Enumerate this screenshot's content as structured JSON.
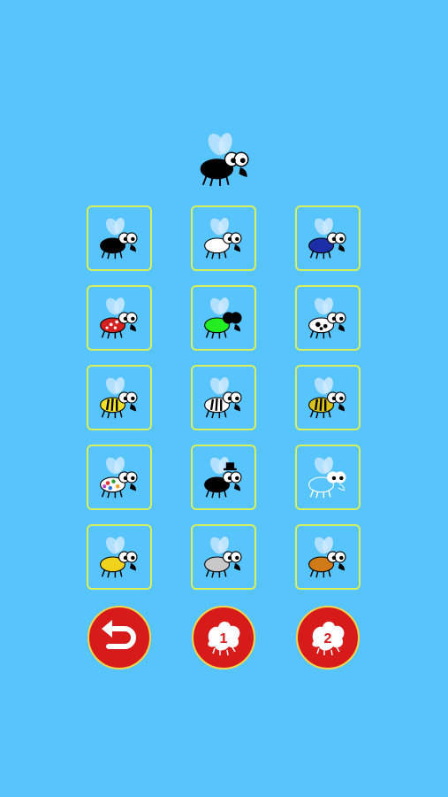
{
  "preview": {
    "skin": "black"
  },
  "skins": [
    {
      "name": "black",
      "body": "#000000",
      "eye": "#ffffff",
      "pattern": "none"
    },
    {
      "name": "white",
      "body": "#ffffff",
      "eye": "#ffffff",
      "pattern": "none"
    },
    {
      "name": "blue",
      "body": "#1c2fa8",
      "eye": "#ffffff",
      "pattern": "none"
    },
    {
      "name": "ladybug",
      "body": "#d52020",
      "eye": "#ffffff",
      "pattern": "dots"
    },
    {
      "name": "green",
      "body": "#22ee22",
      "eye": "#000000",
      "pattern": "none"
    },
    {
      "name": "dalmatian",
      "body": "#ffffff",
      "eye": "#ffffff",
      "pattern": "spots"
    },
    {
      "name": "bee-yellow",
      "body": "#f2e22a",
      "eye": "#ffffff",
      "pattern": "stripes"
    },
    {
      "name": "bee-white",
      "body": "#ffffff",
      "eye": "#ffffff",
      "pattern": "stripes"
    },
    {
      "name": "bee-gold",
      "body": "#d8c21a",
      "eye": "#ffffff",
      "pattern": "stripes"
    },
    {
      "name": "confetti",
      "body": "#ffffff",
      "eye": "#ffffff",
      "pattern": "confetti"
    },
    {
      "name": "top-hat",
      "body": "#000000",
      "eye": "#ffffff",
      "pattern": "hat"
    },
    {
      "name": "ghost-outline",
      "body": "none",
      "eye": "#ffffff",
      "pattern": "outline"
    },
    {
      "name": "yellow",
      "body": "#f1d21c",
      "eye": "#ffffff",
      "pattern": "none"
    },
    {
      "name": "silver",
      "body": "#c8c8c8",
      "eye": "#ffffff",
      "pattern": "none"
    },
    {
      "name": "orange",
      "body": "#d07a18",
      "eye": "#ffffff",
      "pattern": "none"
    }
  ],
  "buttons": {
    "back": {
      "icon": "back-arrow-icon"
    },
    "one": {
      "icon": "splat-one-icon",
      "label": "1"
    },
    "two": {
      "icon": "splat-two-icon",
      "label": "2"
    }
  },
  "colors": {
    "background": "#57c4fb",
    "button": "#d71a1a",
    "border": "#d8f05c"
  }
}
